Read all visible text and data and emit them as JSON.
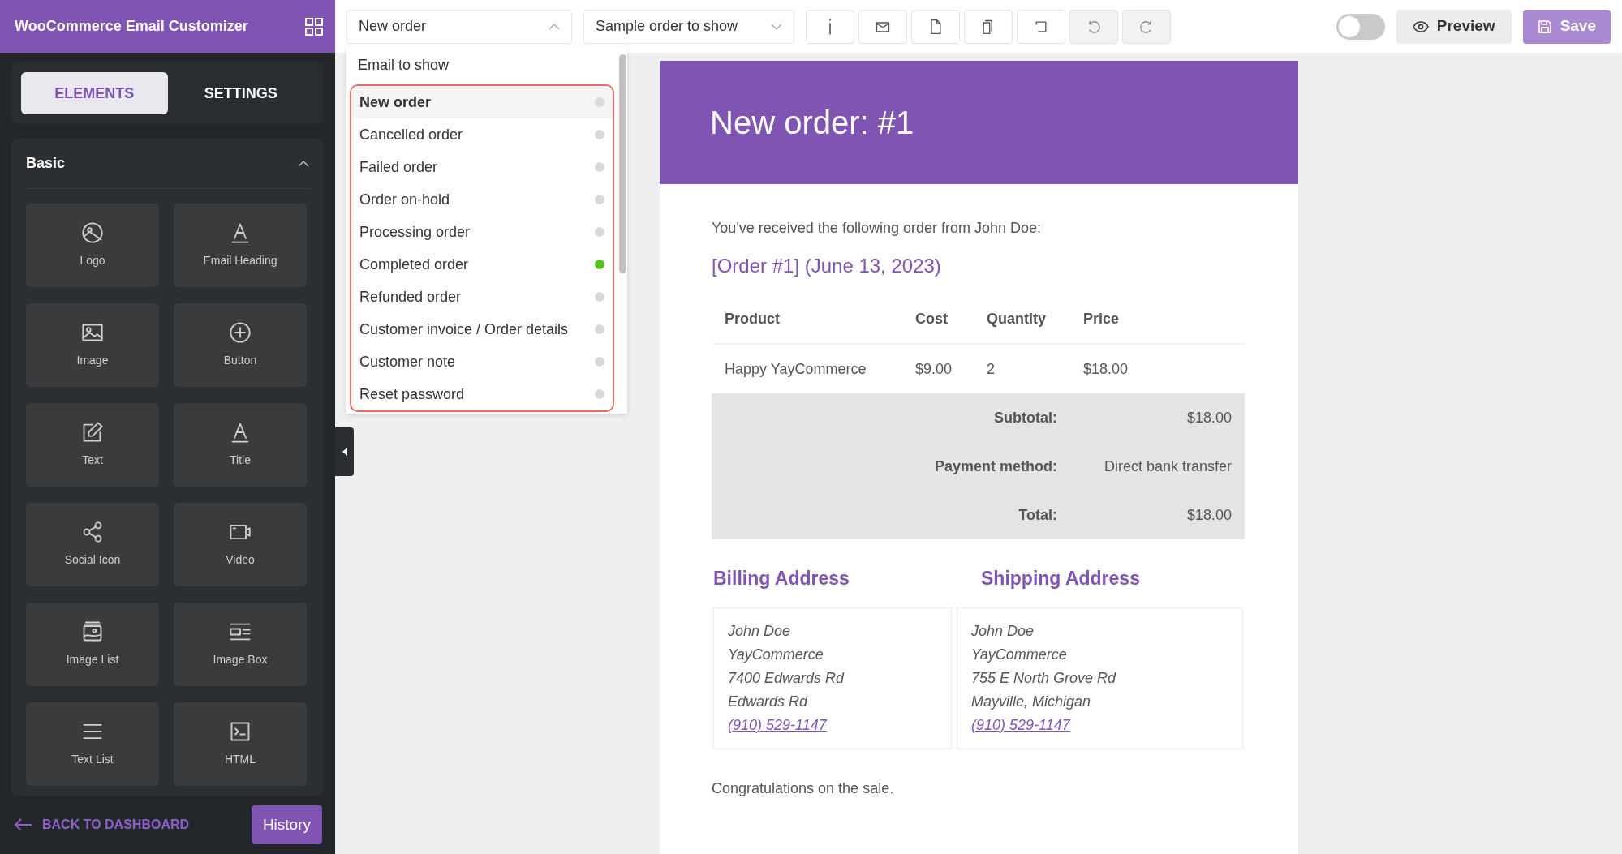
{
  "app": {
    "title": "WooCommerce Email Customizer"
  },
  "sidebar": {
    "tabs": [
      {
        "label": "ELEMENTS",
        "selected": true
      },
      {
        "label": "SETTINGS",
        "selected": false
      }
    ],
    "section": {
      "title": "Basic",
      "expanded": true
    },
    "elements": [
      {
        "label": "Logo",
        "kind": "logo"
      },
      {
        "label": "Email Heading",
        "kind": "heading"
      },
      {
        "label": "Image",
        "kind": "image"
      },
      {
        "label": "Button",
        "kind": "button"
      },
      {
        "label": "Text",
        "kind": "text"
      },
      {
        "label": "Title",
        "kind": "heading"
      },
      {
        "label": "Social Icon",
        "kind": "share"
      },
      {
        "label": "Video",
        "kind": "video"
      },
      {
        "label": "Image List",
        "kind": "imagelist"
      },
      {
        "label": "Image Box",
        "kind": "imagebox"
      },
      {
        "label": "Text List",
        "kind": "textlist"
      },
      {
        "label": "HTML",
        "kind": "html"
      }
    ],
    "back_link": "BACK TO DASHBOARD",
    "history_button": "History"
  },
  "toolbar": {
    "email_select": {
      "value": "New order",
      "expanded": true
    },
    "sample_select": {
      "value": "Sample order to show"
    },
    "tools": [
      {
        "kind": "info",
        "disabled": false
      },
      {
        "kind": "mail",
        "disabled": false
      },
      {
        "kind": "file",
        "disabled": false
      },
      {
        "kind": "copy",
        "disabled": false
      },
      {
        "kind": "return",
        "disabled": false
      },
      {
        "kind": "undo",
        "disabled": true
      },
      {
        "kind": "redo",
        "disabled": true
      }
    ],
    "toggle": {
      "on": false
    },
    "preview": "Preview",
    "save": "Save"
  },
  "email_menu": {
    "header": "Email to show",
    "highlighted": true,
    "items": [
      {
        "label": "New order",
        "selected": true,
        "color": "#d9d9d9"
      },
      {
        "label": "Cancelled order",
        "selected": false,
        "color": "#d9d9d9"
      },
      {
        "label": "Failed order",
        "selected": false,
        "color": "#d9d9d9"
      },
      {
        "label": "Order on-hold",
        "selected": false,
        "color": "#d9d9d9"
      },
      {
        "label": "Processing order",
        "selected": false,
        "color": "#d9d9d9"
      },
      {
        "label": "Completed order",
        "selected": false,
        "color": "#52c41a"
      },
      {
        "label": "Refunded order",
        "selected": false,
        "color": "#d9d9d9"
      },
      {
        "label": "Customer invoice / Order details",
        "selected": false,
        "color": "#d9d9d9"
      },
      {
        "label": "Customer note",
        "selected": false,
        "color": "#d9d9d9"
      },
      {
        "label": "Reset password",
        "selected": false,
        "color": "#d9d9d9"
      }
    ]
  },
  "email": {
    "heading": "New order: #1",
    "intro": "You've received the following order from John Doe:",
    "order_link": "[Order #1] (June 13, 2023)",
    "table": {
      "columns": [
        "Product",
        "Cost",
        "Quantity",
        "Price"
      ],
      "rows": [
        [
          "Happy YayCommerce",
          "$9.00",
          "2",
          "$18.00"
        ]
      ],
      "totals": [
        {
          "label": "Subtotal:",
          "value": "$18.00"
        },
        {
          "label": "Payment method:",
          "value": "Direct bank transfer"
        },
        {
          "label": "Total:",
          "value": "$18.00"
        }
      ]
    },
    "addresses": [
      {
        "title": "Billing Address",
        "lines": [
          "John Doe",
          "YayCommerce",
          "7400 Edwards Rd",
          "Edwards Rd"
        ],
        "phone": "(910) 529-1147"
      },
      {
        "title": "Shipping Address",
        "lines": [
          "John Doe",
          "YayCommerce",
          "755 E North Grove Rd",
          "Mayville, Michigan"
        ],
        "phone": "(910) 529-1147"
      }
    ],
    "closing": "Congratulations on the sale."
  }
}
